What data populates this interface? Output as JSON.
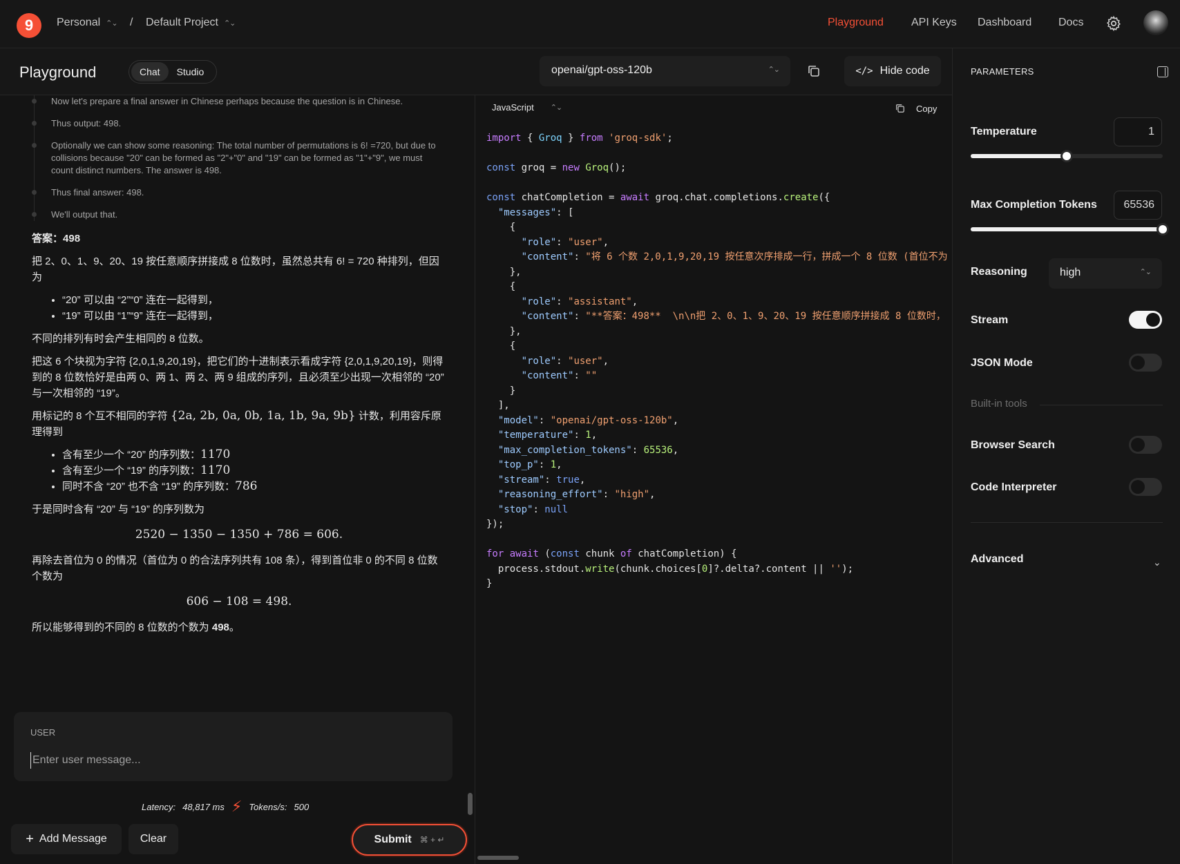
{
  "topbar": {
    "logo": "9",
    "org": "Personal",
    "separator": "/",
    "project": "Default Project",
    "nav": [
      "Playground",
      "API Keys",
      "Dashboard",
      "Docs"
    ]
  },
  "subbar": {
    "title": "Playground",
    "tabs": [
      "Chat",
      "Studio"
    ],
    "model": "openai/gpt-oss-120b",
    "hide_code": "Hide code"
  },
  "chat": {
    "reasoning": [
      "Now let's prepare a final answer in Chinese perhaps because the question is in Chinese.",
      "Thus output: 498.",
      "Optionally we can show some reasoning: The total number of permutations is 6! =720, but due to collisions because \"20\" can be formed as \"2\"+\"0\" and \"19\" can be formed as \"1\"+\"9\", we must count distinct numbers. The answer is 498.",
      "Thus final answer: 498.",
      "We'll output that."
    ],
    "answer_label": "答案：",
    "answer_value": "498",
    "p1": "把 2、0、1、9、20、19 按任意顺序拼接成 8 位数时，虽然总共有 6! = 720 种排列，但因为",
    "bullets1": [
      "“20” 可以由 “2”“0” 连在一起得到，",
      "“19” 可以由 “1”“9” 连在一起得到，"
    ],
    "p2": "不同的排列有时会产生相同的 8 位数。",
    "p3": "把这 6 个块视为字符 {2,0,1,9,20,19}，把它们的十进制表示看成字符 {2,0,1,9,20,19}，则得到的 8 位数恰好是由两 0、两 1、两 2、两 9 组成的序列，且必须至少出现一次相邻的 “20” 与一次相邻的 “19”。",
    "p4_pre": "用标记的 8 个互不相同的字符",
    "p4_math": "{2a, 2b, 0a, 0b, 1a, 1b, 9a, 9b}",
    "p4_post": "计数，利用容斥原理得到",
    "bullets2": [
      {
        "text": "含有至少一个 “20” 的序列数：",
        "num": "1170"
      },
      {
        "text": "含有至少一个 “19” 的序列数：",
        "num": "1170"
      },
      {
        "text": "同时不含 “20” 也不含 “19” 的序列数：",
        "num": "786"
      }
    ],
    "p5": "于是同时含有 “20” 与 “19” 的序列数为",
    "eq1": "2520 − 1350 − 1350 + 786 = 606.",
    "p6": "再除去首位为 0 的情况（首位为 0 的合法序列共有 108 条），得到首位非 0 的不同 8 位数个数为",
    "eq2": "606 − 108 = 498.",
    "p7_pre": "所以能够得到的不同的 8 位数的个数为",
    "p7_bold": "498",
    "p7_post": "。"
  },
  "composer": {
    "label": "USER",
    "placeholder": "Enter user message...",
    "latency_label": "Latency:",
    "latency_value": "48,817 ms",
    "tps_label": "Tokens/s:",
    "tps_value": "500",
    "add_message": "Add Message",
    "clear": "Clear",
    "submit": "Submit",
    "shortcut": "⌘ + ↵"
  },
  "code": {
    "language": "JavaScript",
    "copy": "Copy"
  },
  "params": {
    "header": "PARAMETERS",
    "temperature_label": "Temperature",
    "temperature_value": "1",
    "temperature_fraction": 0.5,
    "max_tokens_label": "Max Completion Tokens",
    "max_tokens_value": "65536",
    "max_tokens_fraction": 1.0,
    "reasoning_label": "Reasoning",
    "reasoning_value": "high",
    "stream_label": "Stream",
    "stream_on": true,
    "json_label": "JSON Mode",
    "json_on": false,
    "builtin_label": "Built-in tools",
    "browser_label": "Browser Search",
    "browser_on": false,
    "code_interp_label": "Code Interpreter",
    "code_interp_on": false,
    "advanced_label": "Advanced"
  },
  "colors": {
    "accent": "#f55036",
    "bg": "#141414",
    "panel": "#171717"
  }
}
